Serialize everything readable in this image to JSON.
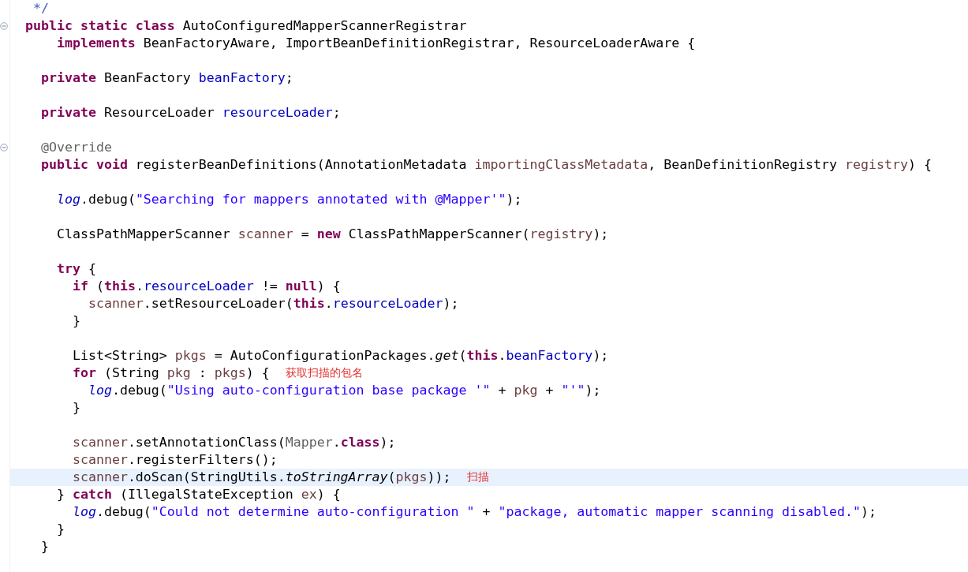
{
  "editor": {
    "lines": [
      {
        "fold_marker": false,
        "current": false,
        "tokens": [
          {
            "kind": "comment",
            "text": " */"
          }
        ]
      },
      {
        "fold_marker": true,
        "current": false,
        "tokens": [
          {
            "kind": "keyword",
            "text": "public static class"
          },
          {
            "kind": "plain",
            "text": " AutoConfiguredMapperScannerRegistrar"
          }
        ]
      },
      {
        "fold_marker": false,
        "current": false,
        "tokens": [
          {
            "kind": "keyword",
            "text": "    implements"
          },
          {
            "kind": "plain",
            "text": " BeanFactoryAware, ImportBeanDefinitionRegistrar, ResourceLoaderAware {"
          }
        ]
      },
      {
        "fold_marker": false,
        "current": false
      },
      {
        "fold_marker": false,
        "current": false,
        "tokens": [
          {
            "kind": "keyword",
            "text": "  private"
          },
          {
            "kind": "plain",
            "text": " BeanFactory "
          },
          {
            "kind": "field",
            "text": "beanFactory"
          },
          {
            "kind": "plain",
            "text": ";"
          }
        ]
      },
      {
        "fold_marker": false,
        "current": false
      },
      {
        "fold_marker": false,
        "current": false,
        "tokens": [
          {
            "kind": "keyword",
            "text": "  private"
          },
          {
            "kind": "plain",
            "text": " ResourceLoader "
          },
          {
            "kind": "field",
            "text": "resourceLoader"
          },
          {
            "kind": "plain",
            "text": ";"
          }
        ]
      },
      {
        "fold_marker": false,
        "current": false
      },
      {
        "fold_marker": true,
        "current": false,
        "tokens": [
          {
            "kind": "annotation",
            "text": "  @Override"
          }
        ]
      },
      {
        "fold_marker": false,
        "current": false,
        "tokens": [
          {
            "kind": "keyword",
            "text": "  public void"
          },
          {
            "kind": "plain",
            "text": " registerBeanDefinitions(AnnotationMetadata "
          },
          {
            "kind": "local",
            "text": "importingClassMetadata"
          },
          {
            "kind": "plain",
            "text": ", BeanDefinitionRegistry "
          },
          {
            "kind": "local",
            "text": "registry"
          },
          {
            "kind": "plain",
            "text": ") {"
          }
        ]
      },
      {
        "fold_marker": false,
        "current": false
      },
      {
        "fold_marker": false,
        "current": false,
        "tokens": [
          {
            "kind": "static_field",
            "text": "    log"
          },
          {
            "kind": "plain",
            "text": ".debug("
          },
          {
            "kind": "string",
            "text": "\"Searching for mappers annotated with @Mapper'\""
          },
          {
            "kind": "plain",
            "text": ");"
          }
        ]
      },
      {
        "fold_marker": false,
        "current": false
      },
      {
        "fold_marker": false,
        "current": false,
        "tokens": [
          {
            "kind": "plain",
            "text": "    ClassPathMapperScanner "
          },
          {
            "kind": "local",
            "text": "scanner"
          },
          {
            "kind": "plain",
            "text": " = "
          },
          {
            "kind": "keyword",
            "text": "new"
          },
          {
            "kind": "plain",
            "text": " ClassPathMapperScanner("
          },
          {
            "kind": "local",
            "text": "registry"
          },
          {
            "kind": "plain",
            "text": ");"
          }
        ]
      },
      {
        "fold_marker": false,
        "current": false
      },
      {
        "fold_marker": false,
        "current": false,
        "tokens": [
          {
            "kind": "keyword",
            "text": "    try"
          },
          {
            "kind": "plain",
            "text": " {"
          }
        ]
      },
      {
        "fold_marker": false,
        "current": false,
        "tokens": [
          {
            "kind": "keyword",
            "text": "      if"
          },
          {
            "kind": "plain",
            "text": " ("
          },
          {
            "kind": "keyword",
            "text": "this"
          },
          {
            "kind": "plain",
            "text": "."
          },
          {
            "kind": "field",
            "text": "resourceLoader"
          },
          {
            "kind": "plain",
            "text": " != "
          },
          {
            "kind": "keyword",
            "text": "null"
          },
          {
            "kind": "plain",
            "text": ") {"
          }
        ]
      },
      {
        "fold_marker": false,
        "current": false,
        "tokens": [
          {
            "kind": "local",
            "text": "        scanner"
          },
          {
            "kind": "plain",
            "text": ".setResourceLoader("
          },
          {
            "kind": "keyword",
            "text": "this"
          },
          {
            "kind": "plain",
            "text": "."
          },
          {
            "kind": "field",
            "text": "resourceLoader"
          },
          {
            "kind": "plain",
            "text": ");"
          }
        ]
      },
      {
        "fold_marker": false,
        "current": false,
        "tokens": [
          {
            "kind": "plain",
            "text": "      }"
          }
        ]
      },
      {
        "fold_marker": false,
        "current": false
      },
      {
        "fold_marker": false,
        "current": false,
        "tokens": [
          {
            "kind": "plain",
            "text": "      List<String> "
          },
          {
            "kind": "local",
            "text": "pkgs"
          },
          {
            "kind": "plain",
            "text": " = AutoConfigurationPackages."
          },
          {
            "kind": "static_method",
            "text": "get"
          },
          {
            "kind": "plain",
            "text": "("
          },
          {
            "kind": "keyword",
            "text": "this"
          },
          {
            "kind": "plain",
            "text": "."
          },
          {
            "kind": "field",
            "text": "beanFactory"
          },
          {
            "kind": "plain",
            "text": ");"
          }
        ]
      },
      {
        "fold_marker": false,
        "current": false,
        "tokens": [
          {
            "kind": "keyword",
            "text": "      for"
          },
          {
            "kind": "plain",
            "text": " (String "
          },
          {
            "kind": "local",
            "text": "pkg"
          },
          {
            "kind": "plain",
            "text": " : "
          },
          {
            "kind": "local",
            "text": "pkgs"
          },
          {
            "kind": "plain",
            "text": ") {"
          }
        ],
        "note": "获取扫描的包名"
      },
      {
        "fold_marker": false,
        "current": false,
        "tokens": [
          {
            "kind": "static_field",
            "text": "        log"
          },
          {
            "kind": "plain",
            "text": ".debug("
          },
          {
            "kind": "string",
            "text": "\"Using auto-configuration base package '\""
          },
          {
            "kind": "plain",
            "text": " + "
          },
          {
            "kind": "local",
            "text": "pkg"
          },
          {
            "kind": "plain",
            "text": " + "
          },
          {
            "kind": "string",
            "text": "\"'\""
          },
          {
            "kind": "plain",
            "text": ");"
          }
        ]
      },
      {
        "fold_marker": false,
        "current": false,
        "tokens": [
          {
            "kind": "plain",
            "text": "      }"
          }
        ]
      },
      {
        "fold_marker": false,
        "current": false
      },
      {
        "fold_marker": false,
        "current": false,
        "tokens": [
          {
            "kind": "local",
            "text": "      scanner"
          },
          {
            "kind": "plain",
            "text": ".setAnnotationClass("
          },
          {
            "kind": "type_ref",
            "text": "Mapper"
          },
          {
            "kind": "plain",
            "text": "."
          },
          {
            "kind": "keyword",
            "text": "class"
          },
          {
            "kind": "plain",
            "text": ");"
          }
        ]
      },
      {
        "fold_marker": false,
        "current": false,
        "tokens": [
          {
            "kind": "local",
            "text": "      scanner"
          },
          {
            "kind": "plain",
            "text": ".registerFilters();"
          }
        ]
      },
      {
        "fold_marker": false,
        "current": true,
        "tokens": [
          {
            "kind": "local",
            "text": "      scanner"
          },
          {
            "kind": "plain",
            "text": ".doScan(StringUtils."
          },
          {
            "kind": "static_method",
            "text": "toStringArray"
          },
          {
            "kind": "plain",
            "text": "("
          },
          {
            "kind": "local",
            "text": "pkgs"
          },
          {
            "kind": "plain",
            "text": "));"
          }
        ],
        "note": "扫描"
      },
      {
        "fold_marker": false,
        "current": false,
        "tokens": [
          {
            "kind": "plain",
            "text": "    } "
          },
          {
            "kind": "keyword",
            "text": "catch"
          },
          {
            "kind": "plain",
            "text": " (IllegalStateException "
          },
          {
            "kind": "local",
            "text": "ex"
          },
          {
            "kind": "plain",
            "text": ") {"
          }
        ]
      },
      {
        "fold_marker": false,
        "current": false,
        "tokens": [
          {
            "kind": "static_field",
            "text": "      log"
          },
          {
            "kind": "plain",
            "text": ".debug("
          },
          {
            "kind": "string",
            "text": "\"Could not determine auto-configuration \""
          },
          {
            "kind": "plain",
            "text": " + "
          },
          {
            "kind": "string",
            "text": "\"package, automatic mapper scanning disabled.\""
          },
          {
            "kind": "plain",
            "text": ");"
          }
        ]
      },
      {
        "fold_marker": false,
        "current": false,
        "tokens": [
          {
            "kind": "plain",
            "text": "    }"
          }
        ]
      },
      {
        "fold_marker": false,
        "current": false,
        "tokens": [
          {
            "kind": "plain",
            "text": "  }"
          }
        ]
      },
      {
        "fold_marker": false,
        "current": false
      }
    ]
  }
}
